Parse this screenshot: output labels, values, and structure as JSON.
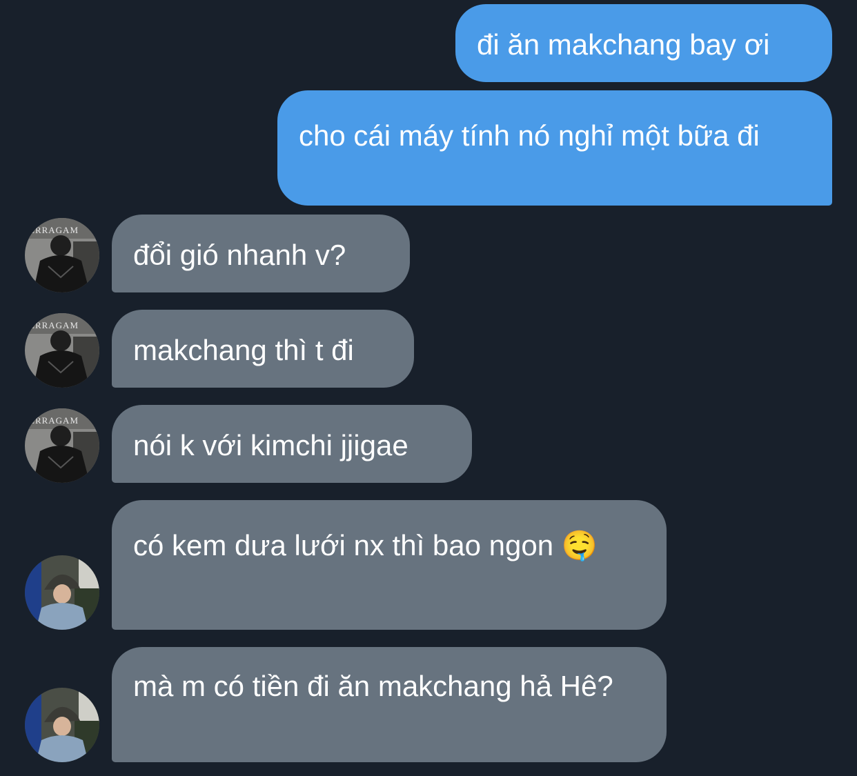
{
  "conversation": {
    "messages": [
      {
        "direction": "outgoing",
        "text": "đi ăn makchang bay ơi"
      },
      {
        "direction": "outgoing",
        "text": "cho cái máy tính nó nghỉ một bữa đi"
      },
      {
        "direction": "incoming",
        "sender_avatar": "avatar-person-a",
        "text": "đổi gió nhanh v?"
      },
      {
        "direction": "incoming",
        "sender_avatar": "avatar-person-a",
        "text": "makchang thì t đi"
      },
      {
        "direction": "incoming",
        "sender_avatar": "avatar-person-a",
        "text": "nói k với kimchi jjigae"
      },
      {
        "direction": "incoming",
        "sender_avatar": "avatar-person-b",
        "text": "có kem dưa lưới nx thì bao ngon 🤤"
      },
      {
        "direction": "incoming",
        "sender_avatar": "avatar-person-b",
        "text": "mà m có tiền đi ăn makchang hả Hê?"
      }
    ]
  },
  "colors": {
    "background": "#18202b",
    "outgoing_bubble": "#4a9be8",
    "incoming_bubble": "#67737f",
    "text": "#ffffff"
  }
}
